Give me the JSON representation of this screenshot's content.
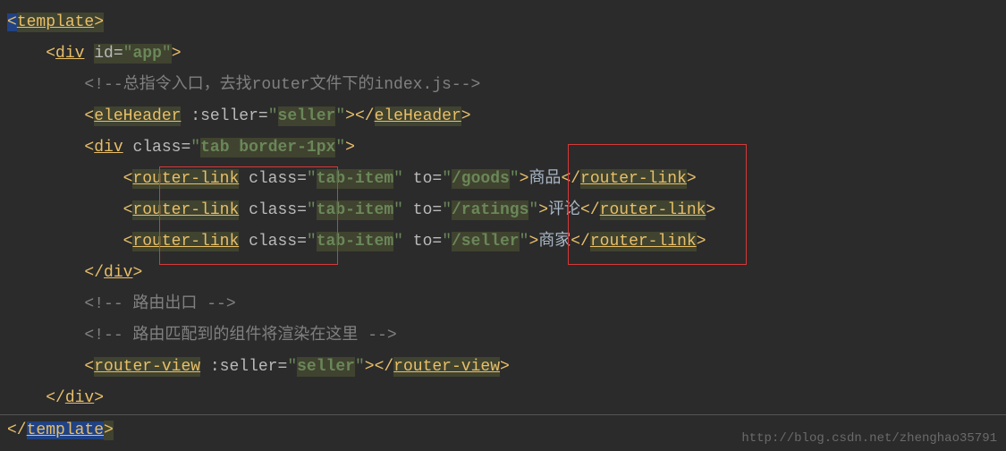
{
  "code": {
    "l1": {
      "open": "<",
      "tag": "template",
      "close": ">"
    },
    "l2": {
      "indent": "    ",
      "open": "<",
      "tag": "div",
      "sp": " ",
      "attr": "id",
      "eq": "=",
      "q": "\"",
      "val": "app",
      "close": ">"
    },
    "l3": {
      "indent": "        ",
      "comment": "<!--总指令入口，去找router文件下的index.js-->"
    },
    "l4": {
      "indent": "        ",
      "open": "<",
      "tag": "eleHeader",
      "sp": " ",
      "attr": ":seller",
      "eq": "=",
      "q": "\"",
      "val": "seller",
      "close": ">",
      "open2": "</",
      "close2": ">"
    },
    "l5": {
      "indent": "        ",
      "open": "<",
      "tag": "div",
      "sp": " ",
      "attr": "class",
      "eq": "=",
      "q": "\"",
      "val": "tab border-1px",
      "close": ">"
    },
    "l6": {
      "indent": "            ",
      "open": "<",
      "tag": "router-link",
      "sp": " ",
      "attr1": "class",
      "val1": "tab-item",
      "attr2": "to",
      "val2": "/goods",
      "close": ">",
      "text": "商品",
      "open2": "</",
      "close2": ">"
    },
    "l7": {
      "indent": "            ",
      "open": "<",
      "tag": "router-link",
      "sp": " ",
      "attr1": "class",
      "val1": "tab-item",
      "attr2": "to",
      "val2": "/ratings",
      "close": ">",
      "text": "评论",
      "open2": "</",
      "close2": ">"
    },
    "l8": {
      "indent": "            ",
      "open": "<",
      "tag": "router-link",
      "sp": " ",
      "attr1": "class",
      "val1": "tab-item",
      "attr2": "to",
      "val2": "/seller",
      "close": ">",
      "text": "商家",
      "open2": "</",
      "close2": ">"
    },
    "l9": {
      "indent": "        ",
      "open": "</",
      "tag": "div",
      "close": ">"
    },
    "l10": {
      "indent": "        ",
      "comment": "<!-- 路由出口 -->"
    },
    "l11": {
      "indent": "        ",
      "comment": "<!-- 路由匹配到的组件将渲染在这里 -->"
    },
    "l12": {
      "indent": "        ",
      "open": "<",
      "tag": "router-view",
      "sp": " ",
      "attr": ":seller",
      "eq": "=",
      "q": "\"",
      "val": "seller",
      "close": ">",
      "open2": "</",
      "close2": ">"
    },
    "l13": {
      "indent": "    ",
      "open": "</",
      "tag": "div",
      "close": ">"
    },
    "l14": {
      "open": "</",
      "tag": "template",
      "close": ">"
    }
  },
  "watermark": "http://blog.csdn.net/zhenghao35791"
}
